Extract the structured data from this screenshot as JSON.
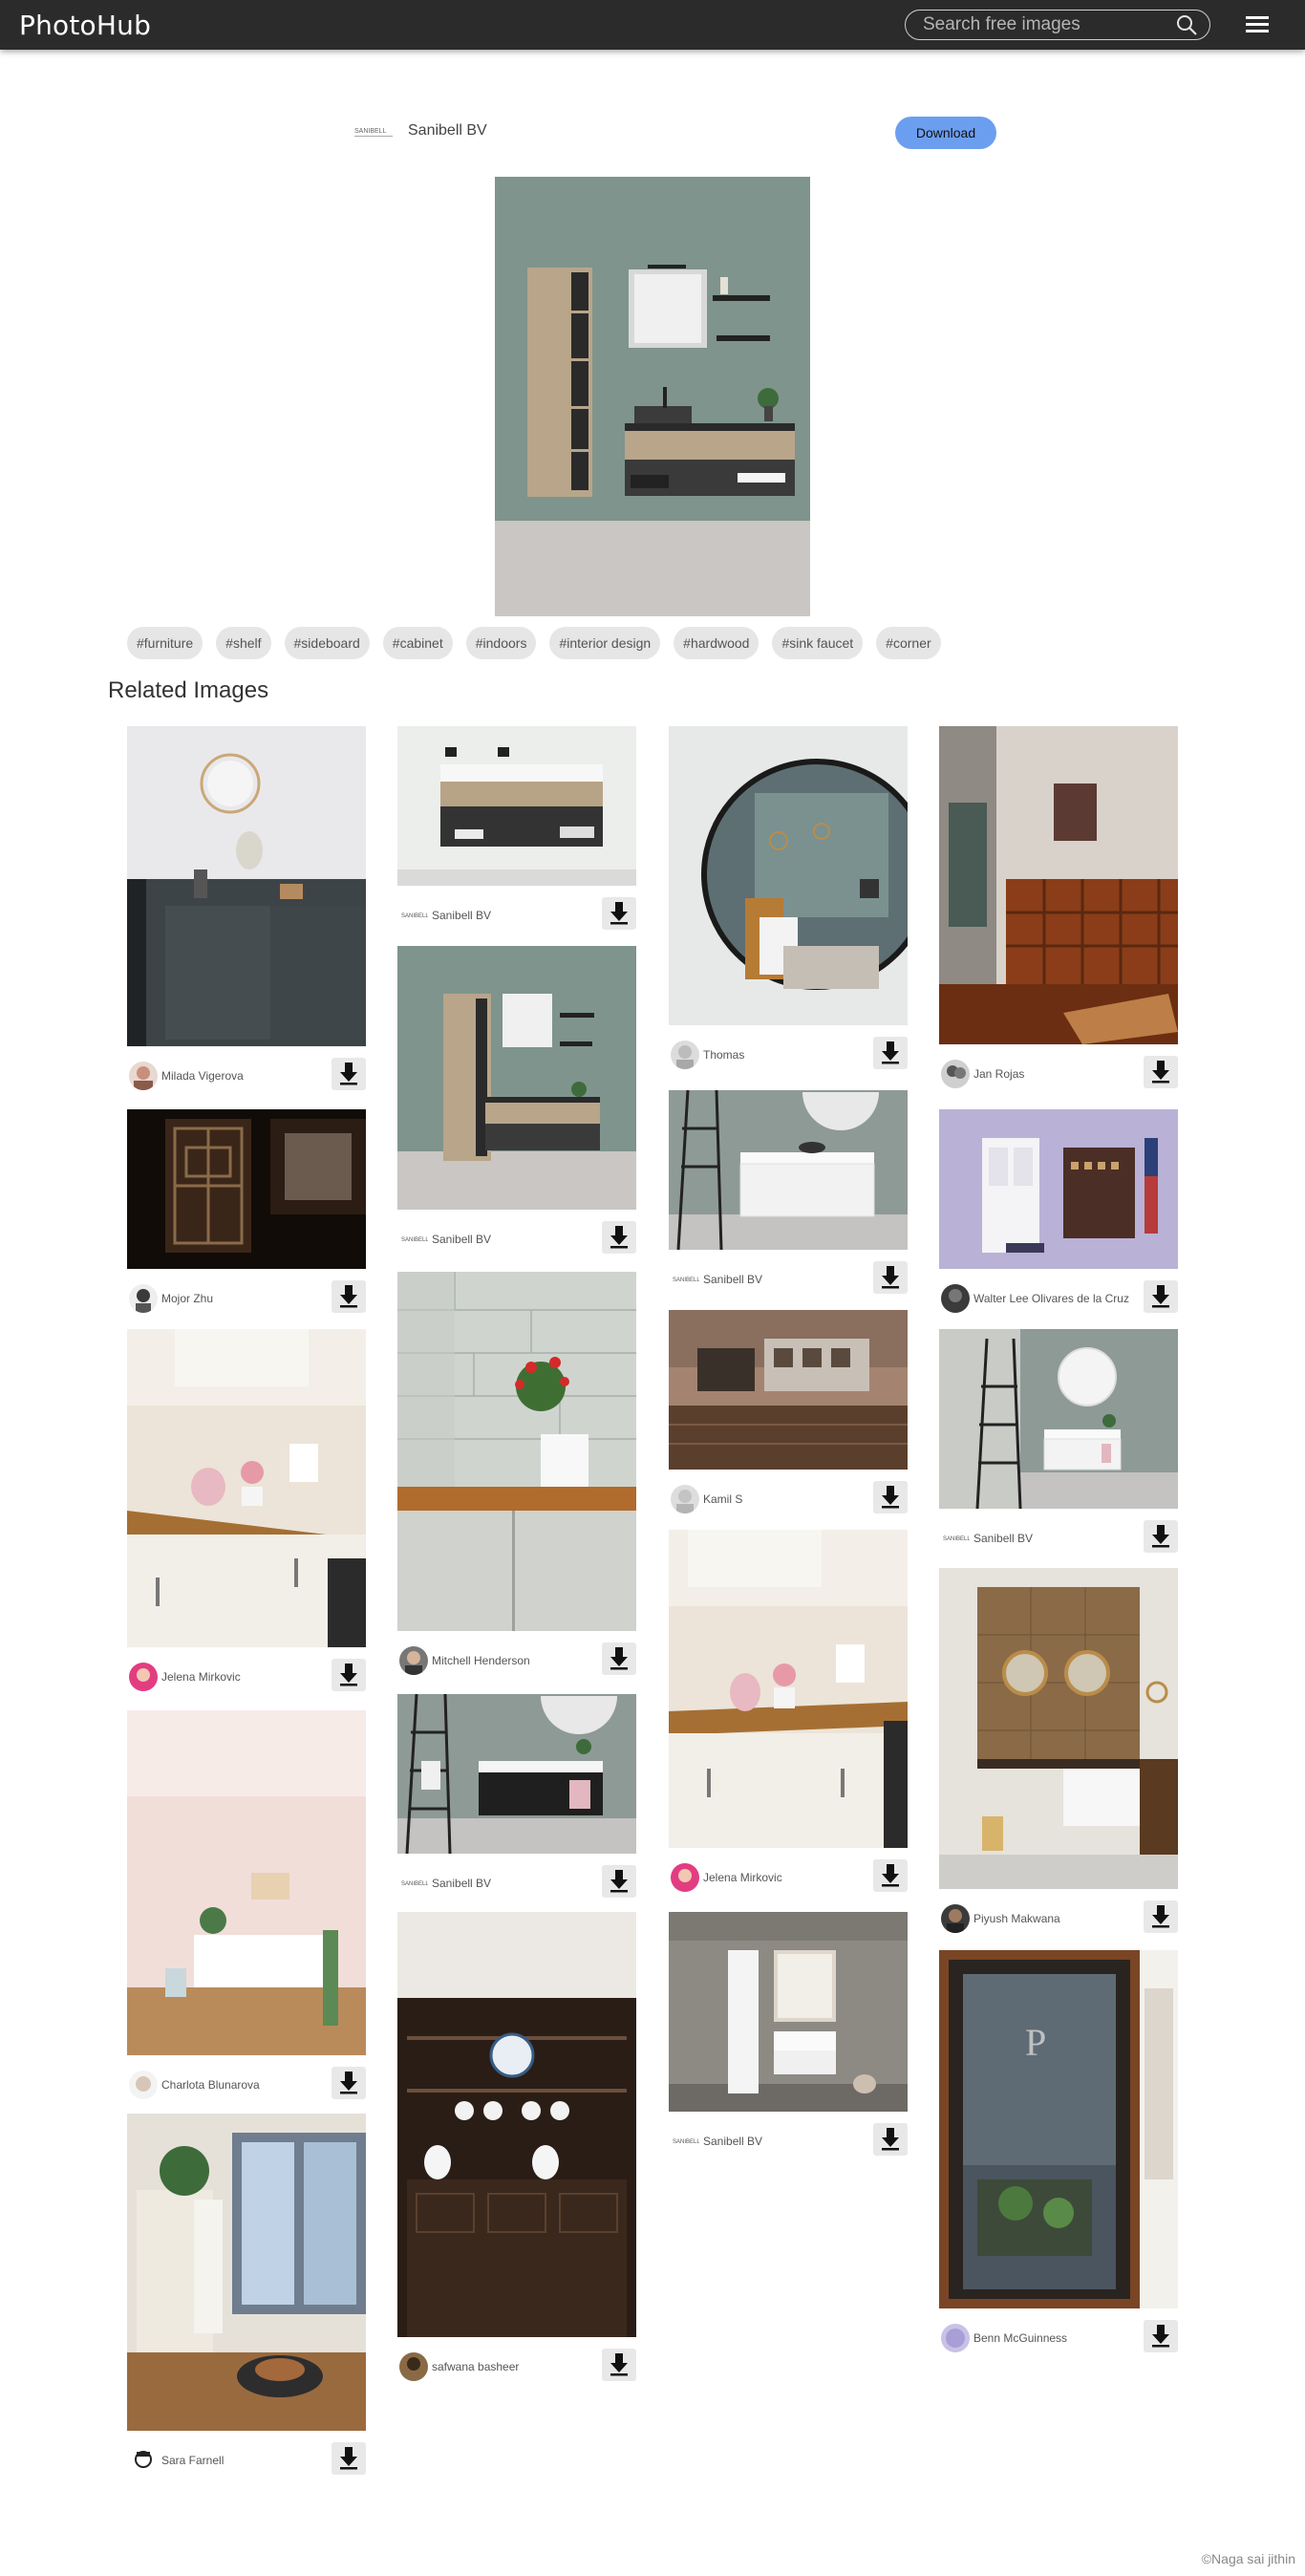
{
  "header": {
    "brand": "PhotoHub",
    "search_placeholder": "Search free images"
  },
  "main": {
    "author": "Sanibell BV",
    "download_label": "Download",
    "tags": [
      "#furniture",
      "#shelf",
      "#sideboard",
      "#cabinet",
      "#indoors",
      "#interior design",
      "#hardwood",
      "#sink faucet",
      "#corner"
    ]
  },
  "related": {
    "title": "Related Images",
    "items": [
      {
        "user": "Milada Vigerova"
      },
      {
        "user": "Mojor Zhu"
      },
      {
        "user": "Jelena Mirkovic"
      },
      {
        "user": "Charlota Blunarova"
      },
      {
        "user": "Sara Farnell"
      },
      {
        "user": "Sanibell BV"
      },
      {
        "user": "Sanibell BV"
      },
      {
        "user": "Mitchell Henderson"
      },
      {
        "user": "Sanibell BV"
      },
      {
        "user": "safwana basheer"
      },
      {
        "user": "Thomas"
      },
      {
        "user": "Sanibell BV"
      },
      {
        "user": "Kamil S"
      },
      {
        "user": "Jelena Mirkovic"
      },
      {
        "user": "Sanibell BV"
      },
      {
        "user": "Jan Rojas"
      },
      {
        "user": "Walter Lee Olivares de la Cruz"
      },
      {
        "user": "Sanibell BV"
      },
      {
        "user": "Piyush Makwana"
      },
      {
        "user": "Benn McGuinness"
      }
    ]
  },
  "footer": {
    "credit": "©Naga sai jithin"
  }
}
